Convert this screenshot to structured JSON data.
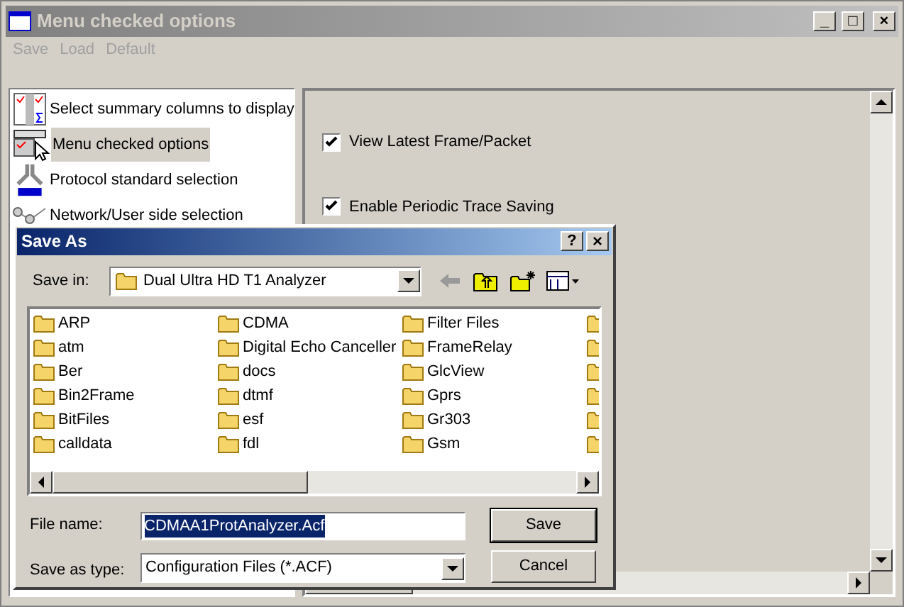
{
  "window": {
    "title": "Menu checked options",
    "controls": [
      "_",
      "□",
      "×"
    ]
  },
  "menu": [
    {
      "label": "Save",
      "disabled": true
    },
    {
      "label": "Load",
      "disabled": true
    },
    {
      "label": "Default",
      "disabled": true
    }
  ],
  "sidebar": {
    "items": [
      {
        "label": "Select summary columns to display",
        "kind": "columns",
        "selected": false
      },
      {
        "label": "Menu checked options",
        "kind": "menu",
        "selected": true
      },
      {
        "label": "Protocol standard selection",
        "kind": "standard",
        "selected": false
      },
      {
        "label": "Network/User side selection",
        "kind": "network",
        "selected": false
      }
    ]
  },
  "options": [
    {
      "label": "View Latest Frame/Packet",
      "checked": true
    },
    {
      "label": "Enable Periodic Trace Saving",
      "checked": true
    }
  ],
  "dialog": {
    "title": "Save As",
    "help": "?",
    "close": "×",
    "save_in_label": "Save in:",
    "save_in_value": "Dual Ultra HD T1 Analyzer",
    "folders": [
      [
        "ARP",
        "atm",
        "Ber",
        "Bin2Frame",
        "BitFiles",
        "calldata"
      ],
      [
        "CDMA",
        "Digital Echo Canceller",
        "docs",
        "dtmf",
        "esf",
        "fdl"
      ],
      [
        "Filter Files",
        "FrameRelay",
        "GlcView",
        "Gprs",
        "Gr303",
        "Gsm"
      ]
    ],
    "file_name_label": "File name:",
    "file_name": "CDMAA1ProtAnalyzer.Acf",
    "type_label": "Save as type:",
    "type_value": "Configuration Files (*.ACF)",
    "buttons": [
      "Save",
      "Cancel"
    ]
  }
}
